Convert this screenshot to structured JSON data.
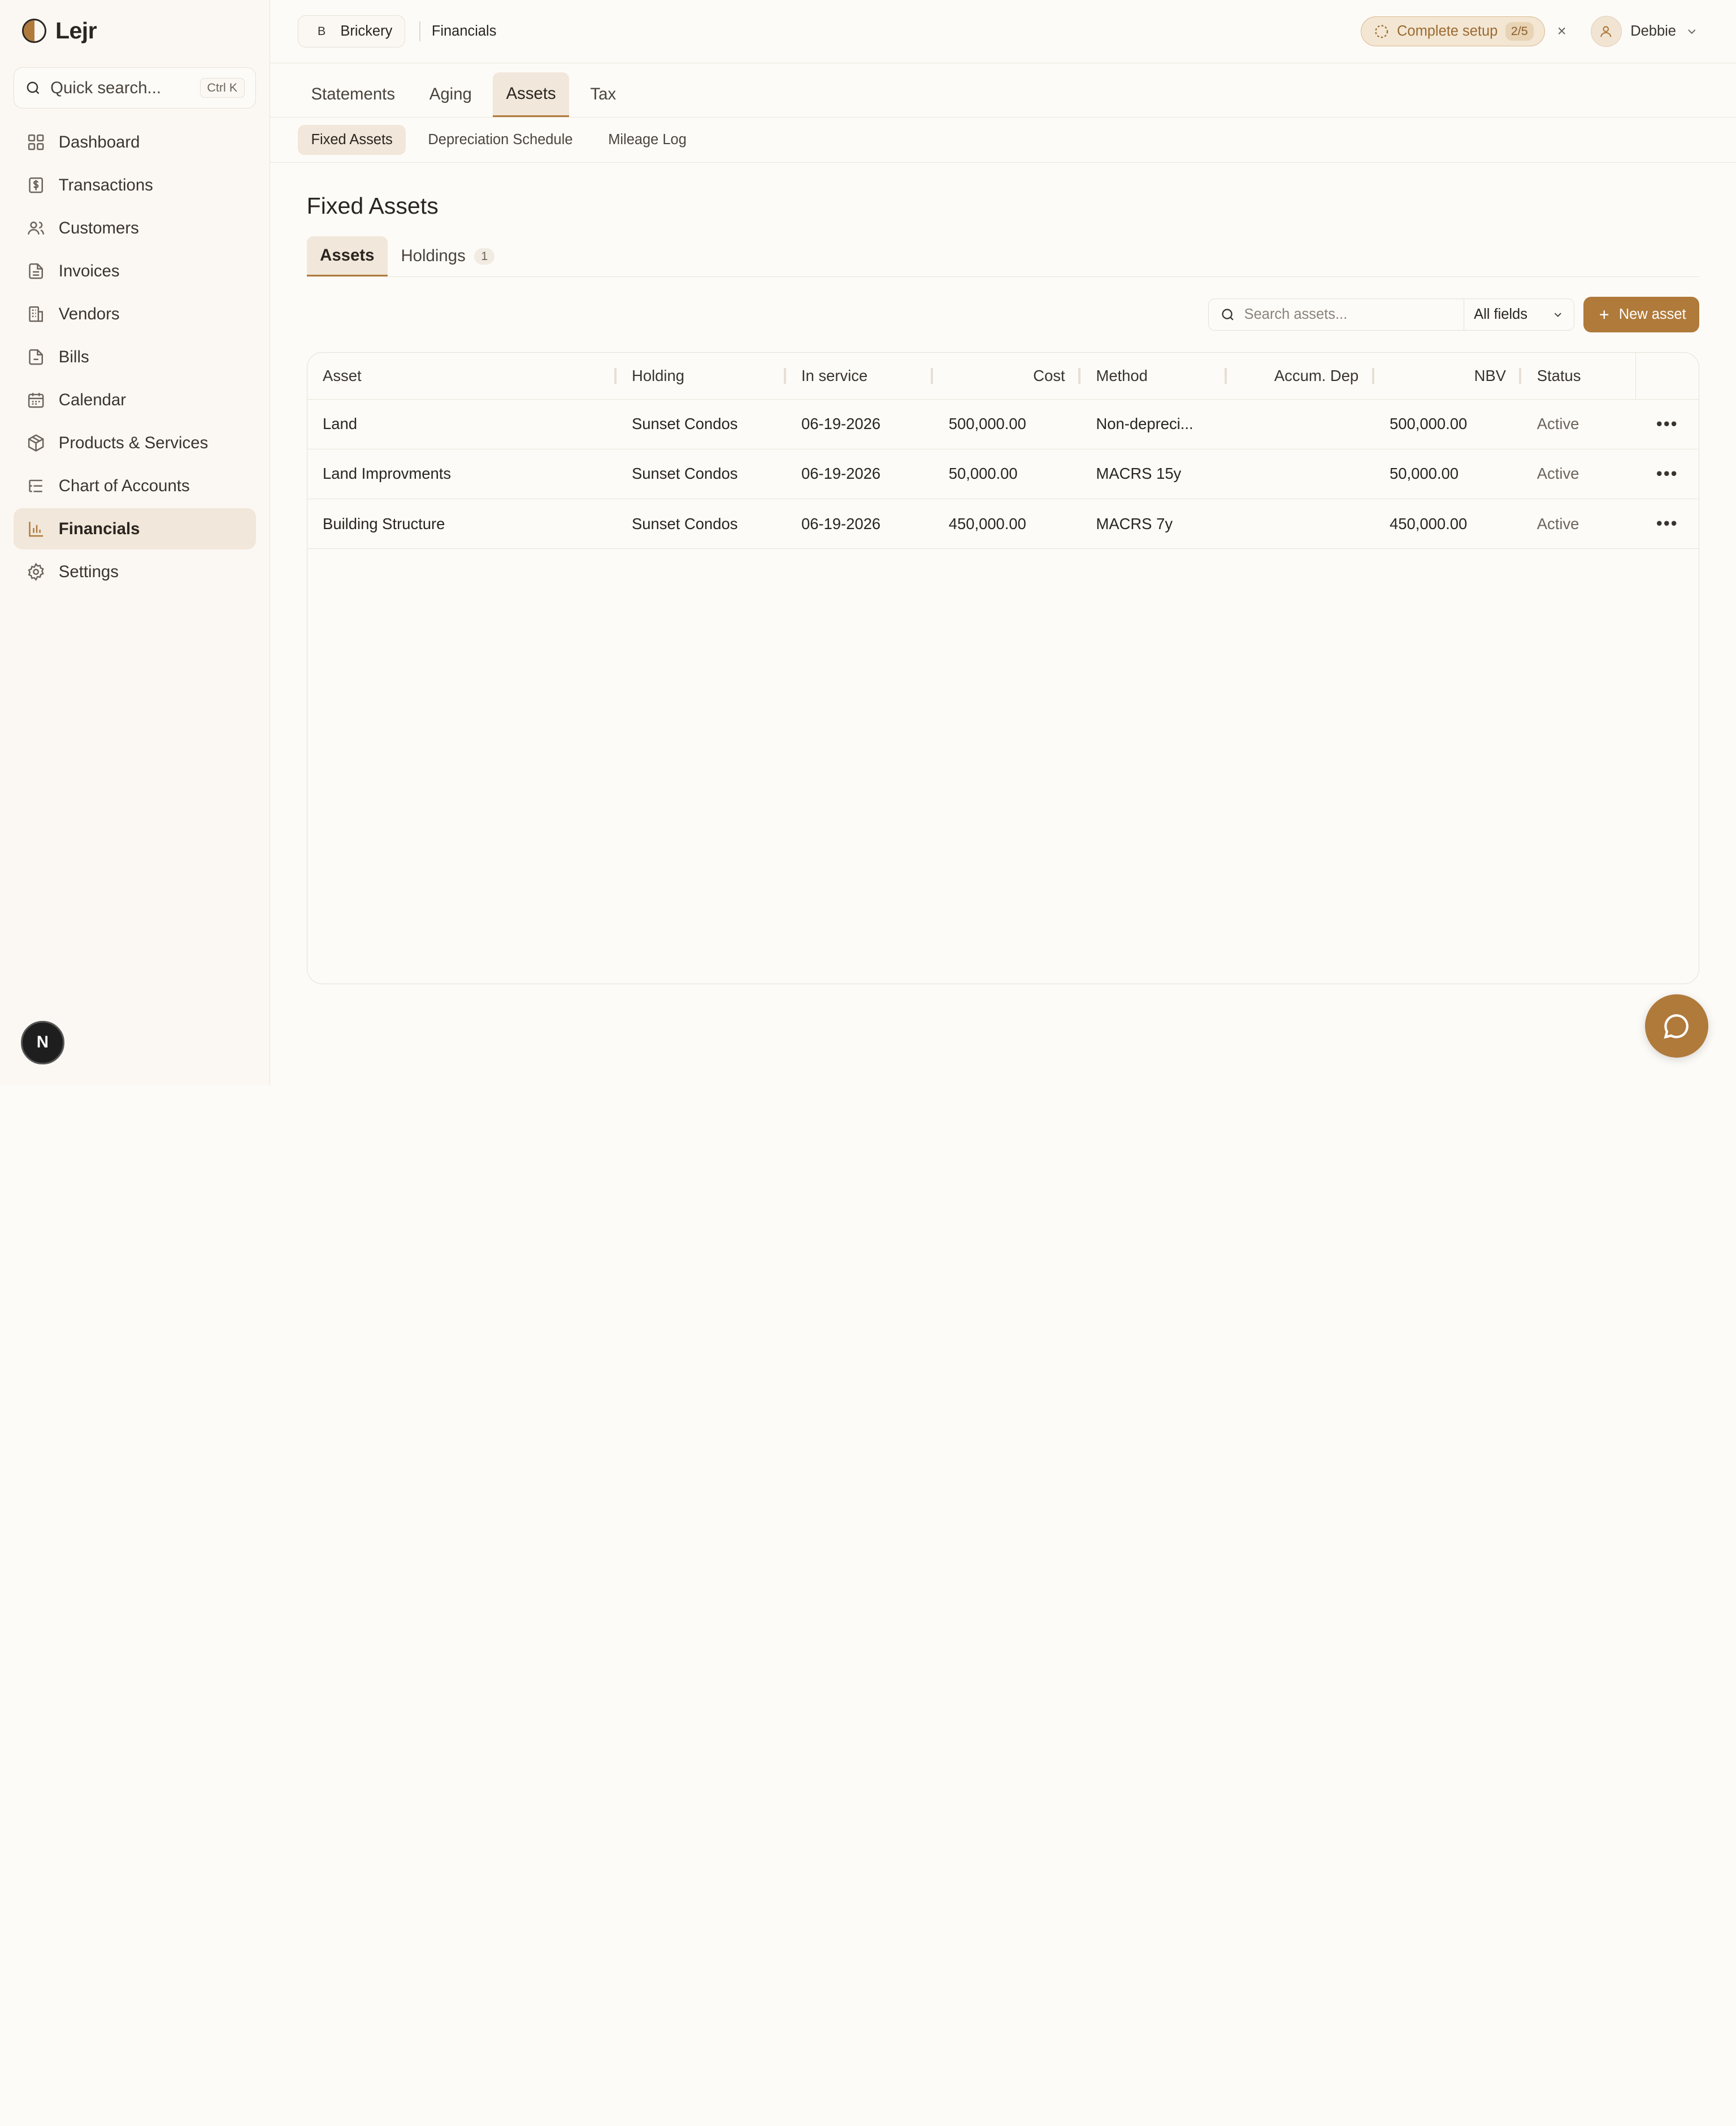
{
  "brand": {
    "name": "Lejr"
  },
  "search": {
    "placeholder": "Quick search...",
    "shortcut": "Ctrl K"
  },
  "sidebar": {
    "items": [
      {
        "label": "Dashboard",
        "icon": "grid-icon"
      },
      {
        "label": "Transactions",
        "icon": "dollar-doc-icon"
      },
      {
        "label": "Customers",
        "icon": "users-icon"
      },
      {
        "label": "Invoices",
        "icon": "file-text-icon"
      },
      {
        "label": "Vendors",
        "icon": "building-icon"
      },
      {
        "label": "Bills",
        "icon": "file-icon"
      },
      {
        "label": "Calendar",
        "icon": "calendar-icon"
      },
      {
        "label": "Products & Services",
        "icon": "box-icon"
      },
      {
        "label": "Chart of Accounts",
        "icon": "list-tree-icon"
      },
      {
        "label": "Financials",
        "icon": "bar-chart-icon",
        "active": true
      },
      {
        "label": "Settings",
        "icon": "gear-icon"
      }
    ],
    "bottom_badge": "N"
  },
  "topbar": {
    "org_initial": "B",
    "org_name": "Brickery",
    "section": "Financials",
    "setup_label": "Complete setup",
    "setup_progress": "2/5",
    "close": "×",
    "user_name": "Debbie"
  },
  "tabs_primary": [
    "Statements",
    "Aging",
    "Assets",
    "Tax"
  ],
  "tabs_secondary": [
    "Fixed Assets",
    "Depreciation Schedule",
    "Mileage Log"
  ],
  "page": {
    "title": "Fixed Assets",
    "tabs": [
      {
        "label": "Assets",
        "count": ""
      },
      {
        "label": "Holdings",
        "count": "1"
      }
    ]
  },
  "toolbar": {
    "search_placeholder": "Search assets...",
    "field_select": "All fields",
    "new_label": "New asset"
  },
  "table": {
    "headers": [
      "Asset",
      "Holding",
      "In service",
      "Cost",
      "Method",
      "Accum. Dep",
      "NBV",
      "Status"
    ],
    "rows": [
      {
        "asset": "Land",
        "holding": "Sunset Condos",
        "in_service": "06-19-2026",
        "cost": "500,000.00",
        "method": "Non-depreci...",
        "accum": "",
        "nbv": "500,000.00",
        "status": "Active"
      },
      {
        "asset": "Land Improvments",
        "holding": "Sunset Condos",
        "in_service": "06-19-2026",
        "cost": "50,000.00",
        "method": "MACRS 15y",
        "accum": "",
        "nbv": "50,000.00",
        "status": "Active"
      },
      {
        "asset": "Building Structure",
        "holding": "Sunset Condos",
        "in_service": "06-19-2026",
        "cost": "450,000.00",
        "method": "MACRS 7y",
        "accum": "",
        "nbv": "450,000.00",
        "status": "Active"
      }
    ]
  },
  "colors": {
    "accent": "#b07a3b",
    "active_bg": "#f1e7da",
    "background": "#fdfbf7"
  }
}
